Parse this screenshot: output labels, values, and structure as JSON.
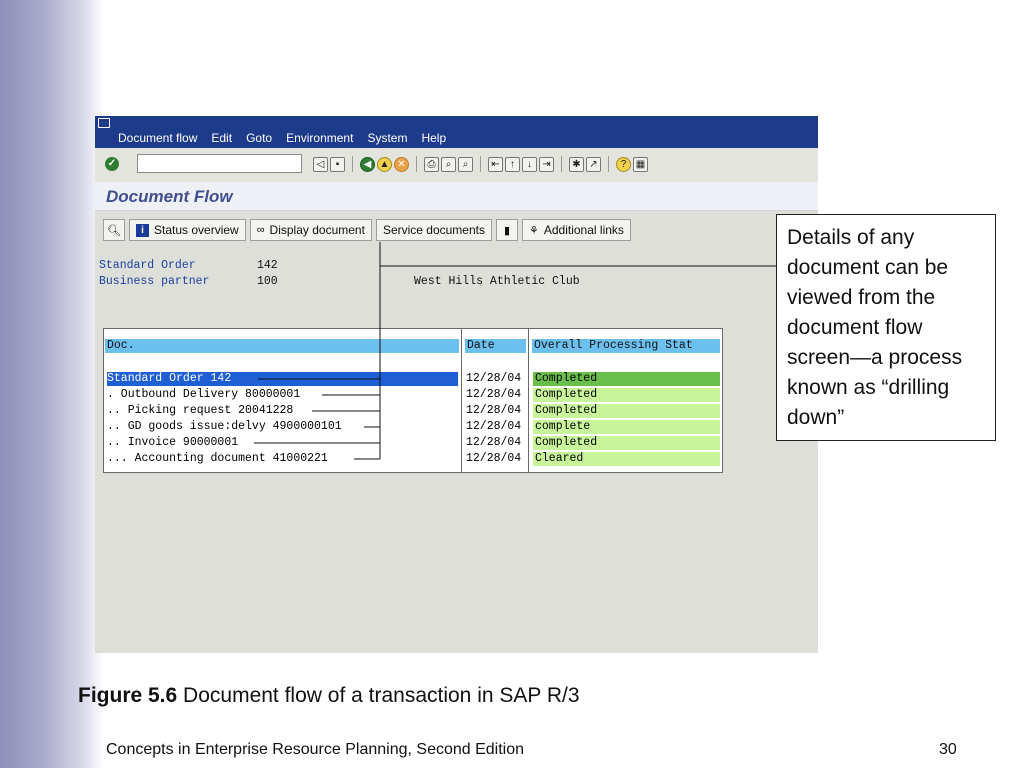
{
  "menu": {
    "items": [
      "Document flow",
      "Edit",
      "Goto",
      "Environment",
      "System",
      "Help"
    ]
  },
  "toolbar": {
    "command_field_value": "",
    "icons": [
      "back-icon",
      "save-icon",
      "green-back-icon",
      "exit-icon",
      "cancel-icon",
      "print-icon",
      "find-icon",
      "find-next-icon",
      "first-page-icon",
      "previous-page-icon",
      "next-page-icon",
      "last-page-icon",
      "new-session-icon",
      "shortcut-icon",
      "help-icon",
      "layout-icon"
    ]
  },
  "screen": {
    "title": "Document Flow"
  },
  "app_toolbar": {
    "status_overview": "Status overview",
    "display_document": "Display document",
    "service_documents": "Service documents",
    "additional_links": "Additional links"
  },
  "header": {
    "standard_order_label": "Standard Order",
    "standard_order_value": "142",
    "business_partner_label": "Business partner",
    "business_partner_value": "100",
    "business_partner_name": "West Hills Athletic Club"
  },
  "grid": {
    "columns": {
      "doc": "Doc.",
      "date": "Date",
      "status": "Overall Processing Stat"
    },
    "rows": [
      {
        "doc": "Standard Order 142",
        "date": "12/28/04",
        "status": "Completed"
      },
      {
        "doc": ". Outbound Delivery 80000001",
        "date": "12/28/04",
        "status": "Completed"
      },
      {
        "doc": ".. Picking request 20041228",
        "date": "12/28/04",
        "status": "Completed"
      },
      {
        "doc": ".. GD goods issue:delvy 4900000101",
        "date": "12/28/04",
        "status": "complete"
      },
      {
        "doc": ".. Invoice 90000001",
        "date": "12/28/04",
        "status": "Completed"
      },
      {
        "doc": "... Accounting document 41000221",
        "date": "12/28/04",
        "status": "Cleared"
      }
    ]
  },
  "callout": {
    "text": "Details of any document can be viewed from the document flow screen—a process known as “drilling down”"
  },
  "caption": {
    "label": "Figure 5.6",
    "text": "Document flow of a transaction in SAP R/3"
  },
  "footer": {
    "left": "Concepts in Enterprise Resource Planning, Second Edition",
    "page_number": "30"
  },
  "colors": {
    "menubar": "#1e3a8a",
    "selected_row": "#1f5fd6",
    "status_cell": "#c8f59a",
    "column_header": "#6bc0ee"
  }
}
